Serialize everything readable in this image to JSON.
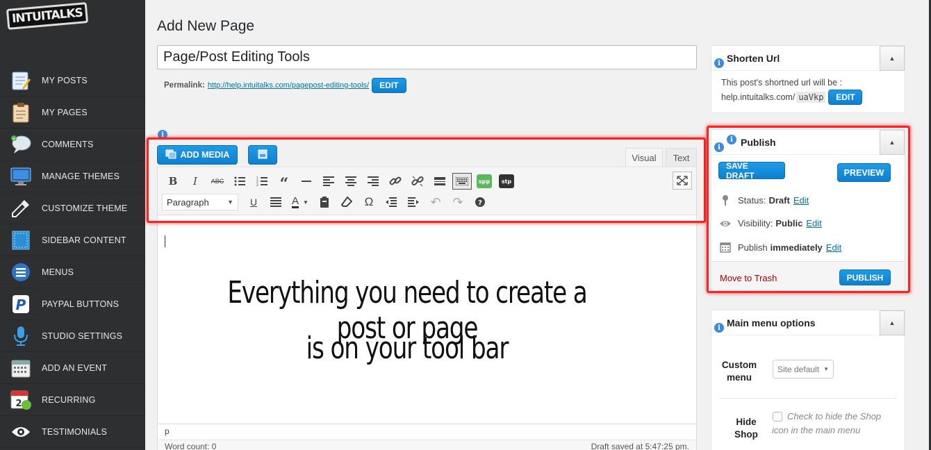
{
  "sidebar": {
    "logo": "INTUITALKS",
    "items": [
      {
        "label": "MY POSTS",
        "icon": "notepad-icon"
      },
      {
        "label": "MY PAGES",
        "icon": "clipboard-icon"
      },
      {
        "label": "COMMENTS",
        "icon": "speech-bubble-icon"
      },
      {
        "label": "MANAGE THEMES",
        "icon": "monitor-icon"
      },
      {
        "label": "CUSTOMIZE THEME",
        "icon": "eyedropper-icon"
      },
      {
        "label": "SIDEBAR CONTENT",
        "icon": "sidebar-grid-icon"
      },
      {
        "label": "MENUS",
        "icon": "menu-list-icon"
      },
      {
        "label": "PAYPAL BUTTONS",
        "icon": "paypal-icon"
      },
      {
        "label": "STUDIO SETTINGS",
        "icon": "microphone-icon"
      },
      {
        "label": "ADD AN EVENT",
        "icon": "calendar-icon"
      },
      {
        "label": "RECURRING",
        "icon": "recurring-calendar-icon"
      },
      {
        "label": "TESTIMONIALS",
        "icon": "eye-icon"
      }
    ]
  },
  "main": {
    "page_title": "Add New Page",
    "title_value": "Page/Post Editing Tools",
    "permalink_label": "Permalink:",
    "permalink_url": "http://help.intuitalks.com/pagepost-editing-tools/",
    "permalink_edit": "EDIT",
    "add_media_label": "ADD MEDIA",
    "tab_visual": "Visual",
    "tab_text": "Text",
    "format_value": "Paragraph",
    "content_line1": "Everything you need to create a post or page",
    "content_line2": "is on your tool bar",
    "path": "p",
    "word_count": "Word count: 0",
    "draft_saved": "Draft saved at 5:47:25 pm."
  },
  "shorten_url": {
    "title": "Shorten Url",
    "text": "This post's shortned url will be :",
    "base": "help.intuitalks.com/",
    "code": "uaVkp",
    "edit": "EDIT"
  },
  "publish": {
    "title": "Publish",
    "save_draft": "SAVE DRAFT",
    "preview": "PREVIEW",
    "status_label": "Status:",
    "status_value": "Draft",
    "visibility_label": "Visibility:",
    "visibility_value": "Public",
    "publish_label": "Publish",
    "publish_value": "immediately",
    "edit": "Edit",
    "move_to_trash": "Move to Trash",
    "publish_button": "PUBLISH"
  },
  "main_menu_options": {
    "title": "Main menu options",
    "custom_menu_label": "Custom menu",
    "custom_menu_value": "Site default",
    "hide_shop_label": "Hide Shop",
    "hide_shop_desc": "Check to hide the Shop icon in the main menu"
  },
  "colors": {
    "sidebar_bg": "#2e2f30",
    "accent_blue": "#1e8fe0",
    "highlight_red": "#ff2222",
    "trash_red": "#aa0000"
  }
}
